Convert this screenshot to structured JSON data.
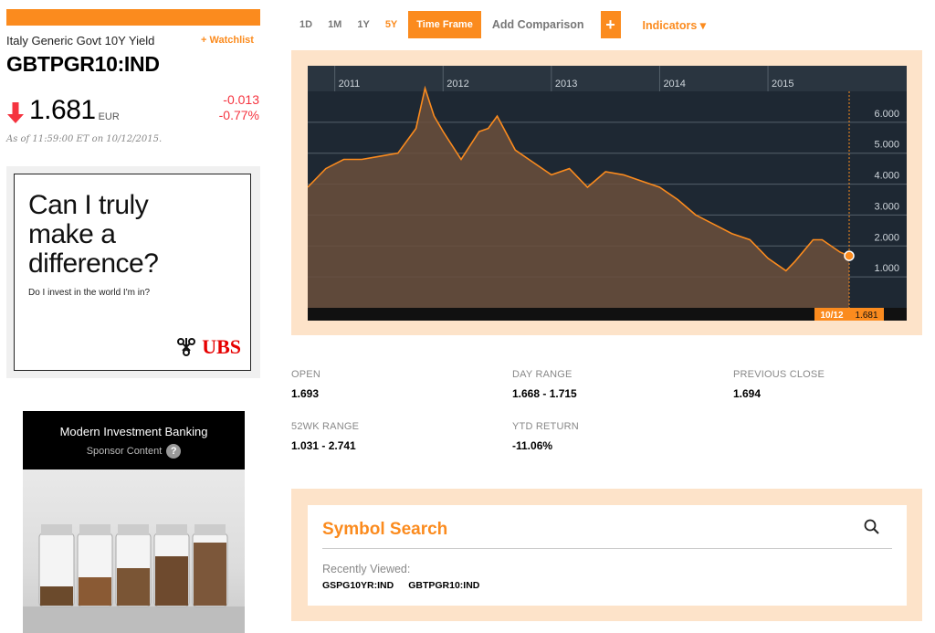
{
  "security": {
    "name": "Italy Generic Govt 10Y Yield",
    "ticker": "GBTPGR10:IND",
    "watchlist_label": "+ Watchlist",
    "price": "1.681",
    "currency": "EUR",
    "change": "-0.013",
    "change_pct": "-0.77%",
    "as_of": "As of 11:59:00 ET on 10/12/2015."
  },
  "toolbar": {
    "timeframes": [
      "1D",
      "1M",
      "1Y",
      "5Y"
    ],
    "active_timeframe": "5Y",
    "time_frame_label": "Time Frame",
    "add_comparison_label": "Add Comparison",
    "plus_label": "+",
    "indicators_label": "Indicators ▾"
  },
  "chart_data": {
    "type": "area",
    "x_labels": [
      "2011",
      "2012",
      "2013",
      "2014",
      "2015"
    ],
    "y_ticks": [
      "6.000",
      "5.000",
      "4.000",
      "3.000",
      "2.000",
      "1.000"
    ],
    "ylim": [
      0,
      7
    ],
    "x": [
      "2010-10",
      "2010-12",
      "2011-02",
      "2011-04",
      "2011-06",
      "2011-08",
      "2011-10",
      "2011-11",
      "2011-12",
      "2012-01",
      "2012-03",
      "2012-05",
      "2012-06",
      "2012-07",
      "2012-09",
      "2012-11",
      "2013-01",
      "2013-03",
      "2013-05",
      "2013-07",
      "2013-09",
      "2013-11",
      "2014-01",
      "2014-03",
      "2014-05",
      "2014-07",
      "2014-09",
      "2014-11",
      "2015-01",
      "2015-03",
      "2015-04",
      "2015-06",
      "2015-07",
      "2015-09",
      "2015-10"
    ],
    "values": [
      3.9,
      4.5,
      4.8,
      4.8,
      4.9,
      5.0,
      5.8,
      7.1,
      6.2,
      5.7,
      4.8,
      5.7,
      5.8,
      6.2,
      5.1,
      4.7,
      4.3,
      4.5,
      3.9,
      4.4,
      4.3,
      4.1,
      3.9,
      3.5,
      3.0,
      2.7,
      2.4,
      2.2,
      1.6,
      1.2,
      1.5,
      2.2,
      2.2,
      1.8,
      1.681
    ],
    "last_label_date": "10/12",
    "last_label_value": "1.681"
  },
  "stats": [
    {
      "label": "OPEN",
      "value": "1.693"
    },
    {
      "label": "DAY RANGE",
      "value": "1.668 - 1.715"
    },
    {
      "label": "PREVIOUS CLOSE",
      "value": "1.694"
    },
    {
      "label": "52WK RANGE",
      "value": "1.031 - 2.741"
    },
    {
      "label": "YTD RETURN",
      "value": "-11.06%"
    }
  ],
  "ad1": {
    "headline": "Can I truly make a difference?",
    "sub": "Do I invest in the world I'm in?",
    "brand": "UBS"
  },
  "ad2": {
    "title": "Modern Investment Banking",
    "sponsor": "Sponsor Content",
    "help": "?"
  },
  "symbol_search": {
    "title": "Symbol Search",
    "recently_viewed_label": "Recently Viewed:",
    "recent": [
      "GSPG10YR:IND",
      "GBTPGR10:IND"
    ]
  },
  "colors": {
    "accent": "#fb8b1e",
    "negative": "#f5333f",
    "chart_bg": "#1e2833",
    "frame": "#fde3c9"
  }
}
